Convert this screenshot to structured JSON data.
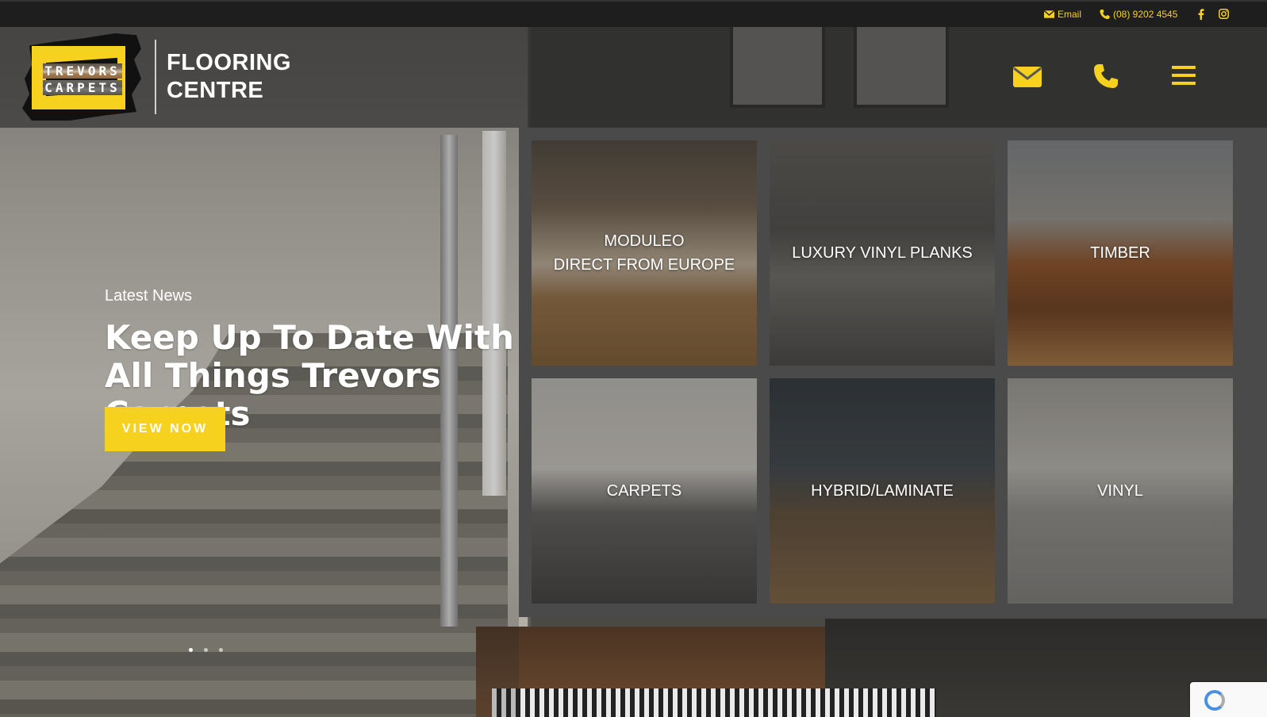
{
  "topbar": {
    "email_label": "Email",
    "phone_label": "(08) 9202 4545",
    "icons": [
      "envelope-icon",
      "phone-icon",
      "facebook-icon",
      "instagram-icon"
    ]
  },
  "logo": {
    "line1": "TREVORS",
    "line2": "CARPETS"
  },
  "brand": {
    "line1": "FLOORING",
    "line2": "CENTRE"
  },
  "header_icons": [
    "envelope-icon",
    "phone-icon",
    "menu-icon"
  ],
  "hero": {
    "eyebrow": "Latest News",
    "headline": "Keep Up To Date With All Things Trevors Carpets",
    "cta_label": "VIEW NOW",
    "slides": 3,
    "active_slide": 1
  },
  "categories": [
    {
      "label": "MODULEO\nDIRECT FROM EUROPE"
    },
    {
      "label": "LUXURY VINYL PLANKS"
    },
    {
      "label": "TIMBER"
    },
    {
      "label": "CARPETS"
    },
    {
      "label": "HYBRID/LAMINATE"
    },
    {
      "label": "VINYL"
    }
  ],
  "colors": {
    "accent": "#f6d21f",
    "topbar": "#1f1e1e",
    "grid_panel": "#4a4a4a"
  }
}
